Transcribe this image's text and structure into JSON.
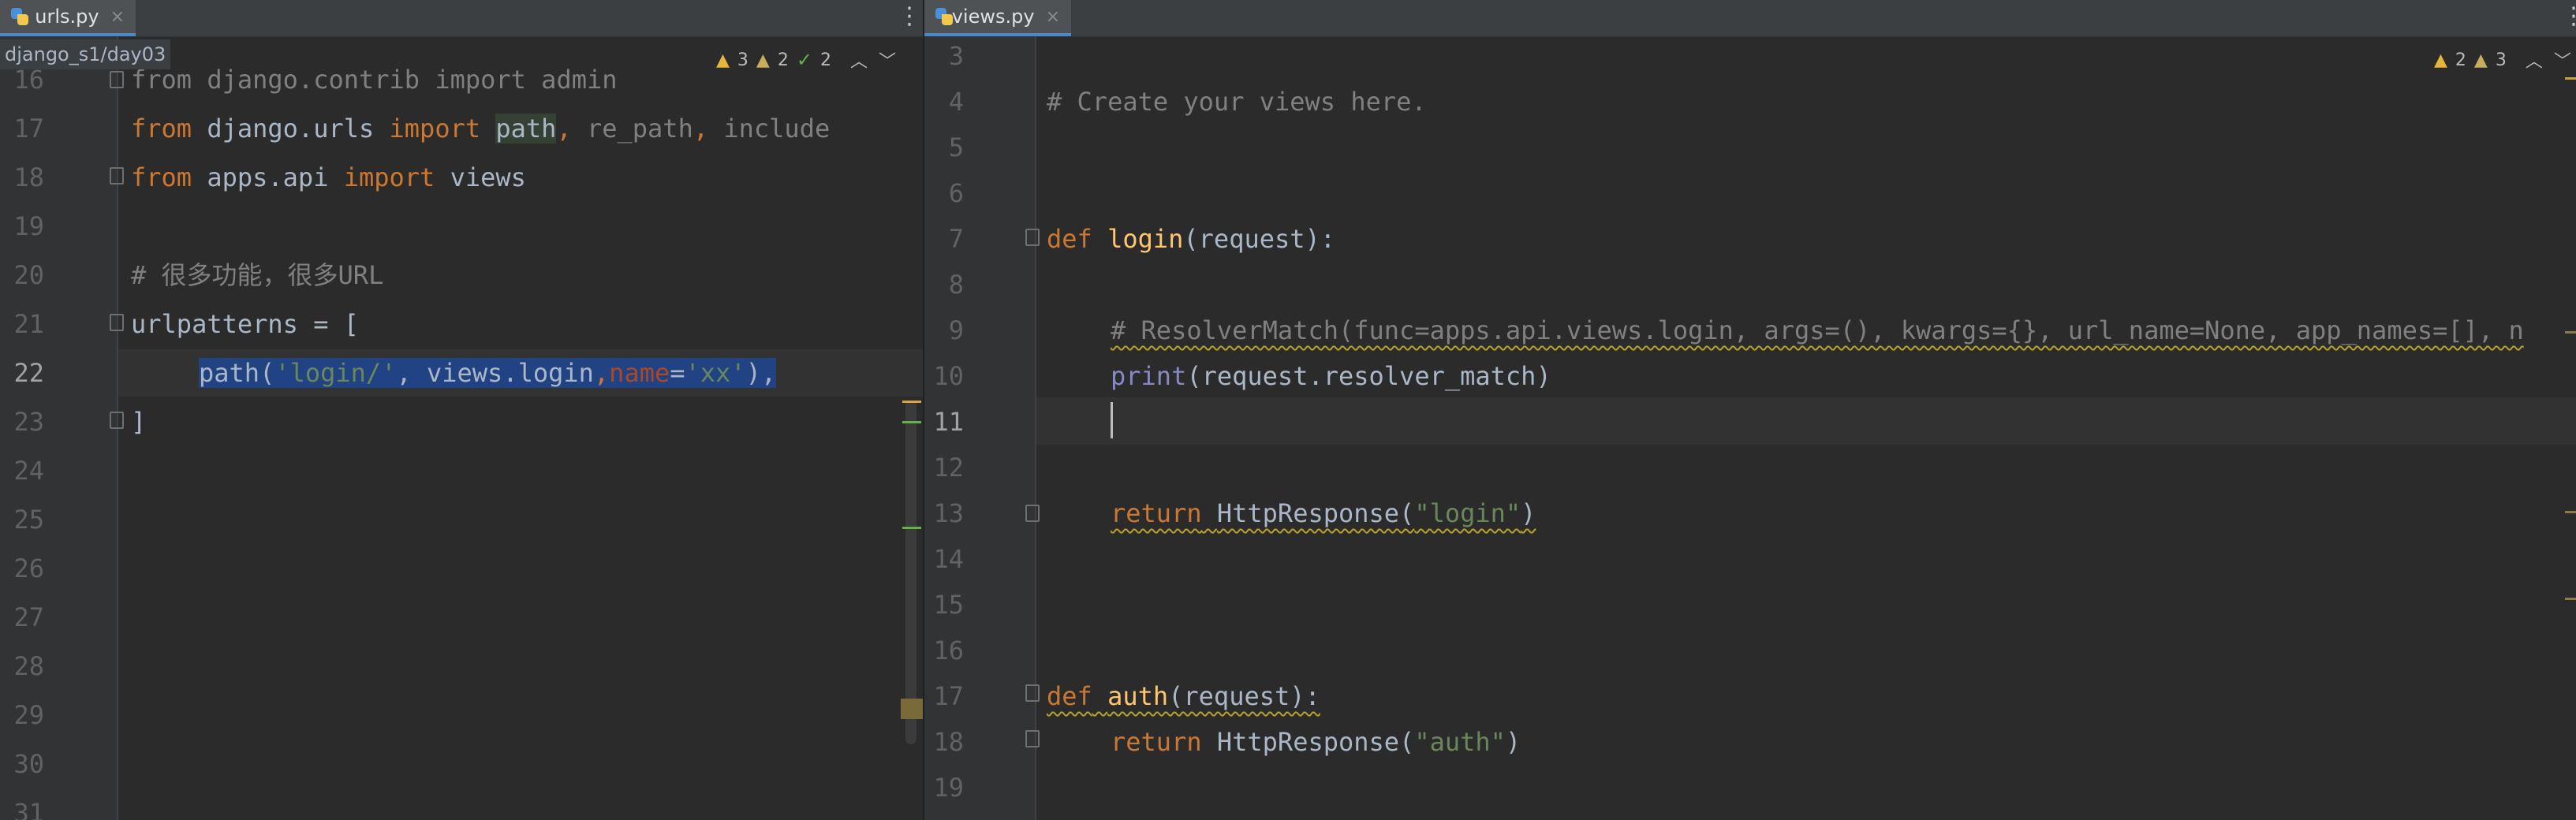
{
  "left_editor": {
    "tab": {
      "label": "urls.py",
      "close": "×"
    },
    "breadcrumb": "django_s1/day03",
    "inspections": {
      "warnings": "3",
      "weak_warnings": "2",
      "ok": "2"
    },
    "line_numbers": [
      "16",
      "17",
      "18",
      "19",
      "20",
      "21",
      "22",
      "23",
      "24",
      "25",
      "26",
      "27",
      "28",
      "29",
      "30",
      "31"
    ],
    "lines": {
      "l16": {
        "kw1": "from",
        "mod": " django.contrib ",
        "kw2": "import",
        "name": " admin"
      },
      "l17": {
        "kw1": "from",
        "mod": " django.urls ",
        "kw2": "import",
        "sp": " ",
        "p1": "path",
        "c1": ", ",
        "p2": "re_path",
        "c2": ", ",
        "p3": "include"
      },
      "l18": {
        "kw1": "from",
        "mod": " apps.api ",
        "kw2": "import",
        "name": " views"
      },
      "l20": {
        "comment": "# 很多功能，很多URL"
      },
      "l21": {
        "text": "urlpatterns = ["
      },
      "l22": {
        "fn": "path(",
        "s1": "'login/'",
        "c1": ", views.login",
        "c2": ",",
        "par": "name",
        "eq": "=",
        "s2": "'xx'",
        "tail": "),"
      },
      "l23": {
        "text": "]"
      }
    }
  },
  "right_editor": {
    "tab": {
      "label": "views.py",
      "close": "×"
    },
    "inspections": {
      "warnings": "2",
      "weak_warnings": "3"
    },
    "line_numbers": [
      "3",
      "4",
      "5",
      "6",
      "7",
      "8",
      "9",
      "10",
      "11",
      "12",
      "13",
      "14",
      "15",
      "16",
      "17",
      "18",
      "19"
    ],
    "lines": {
      "l4": {
        "comment": "# Create your views here."
      },
      "l7": {
        "kw": "def",
        "fn": " login",
        "rest": "(request):"
      },
      "l9": {
        "comment": "# ResolverMatch(func=apps.api.views.login, args=(), kwargs={}, url_name=None, app_names=[], n"
      },
      "l10": {
        "bi": "print",
        "rest": "(request.resolver_match)"
      },
      "l13": {
        "kw": "return",
        "sp": " ",
        "cls": "HttpResponse",
        "open": "(",
        "str": "\"login\"",
        "close": ")"
      },
      "l17": {
        "kw": "def",
        "sp": " ",
        "fn": "auth",
        "rest": "(request):"
      },
      "l18": {
        "kw": "return",
        "sp": " ",
        "cls": "HttpResponse",
        "open": "(",
        "str": "\"auth\"",
        "close": ")"
      }
    }
  },
  "colors": {
    "background": "#2b2b2b",
    "keyword": "#cc7832",
    "string": "#6a8759",
    "comment": "#808080",
    "function": "#ffc66d",
    "builtin": "#8888c6",
    "selection": "#214283",
    "active_tab_underline": "#4a88c7"
  },
  "icons": {
    "file": "python-file-icon",
    "warning": "warning-triangle-icon",
    "ok": "checkmark-icon",
    "menu": "kebab-menu-icon",
    "prev": "chevron-up-icon",
    "next": "chevron-down-icon"
  }
}
